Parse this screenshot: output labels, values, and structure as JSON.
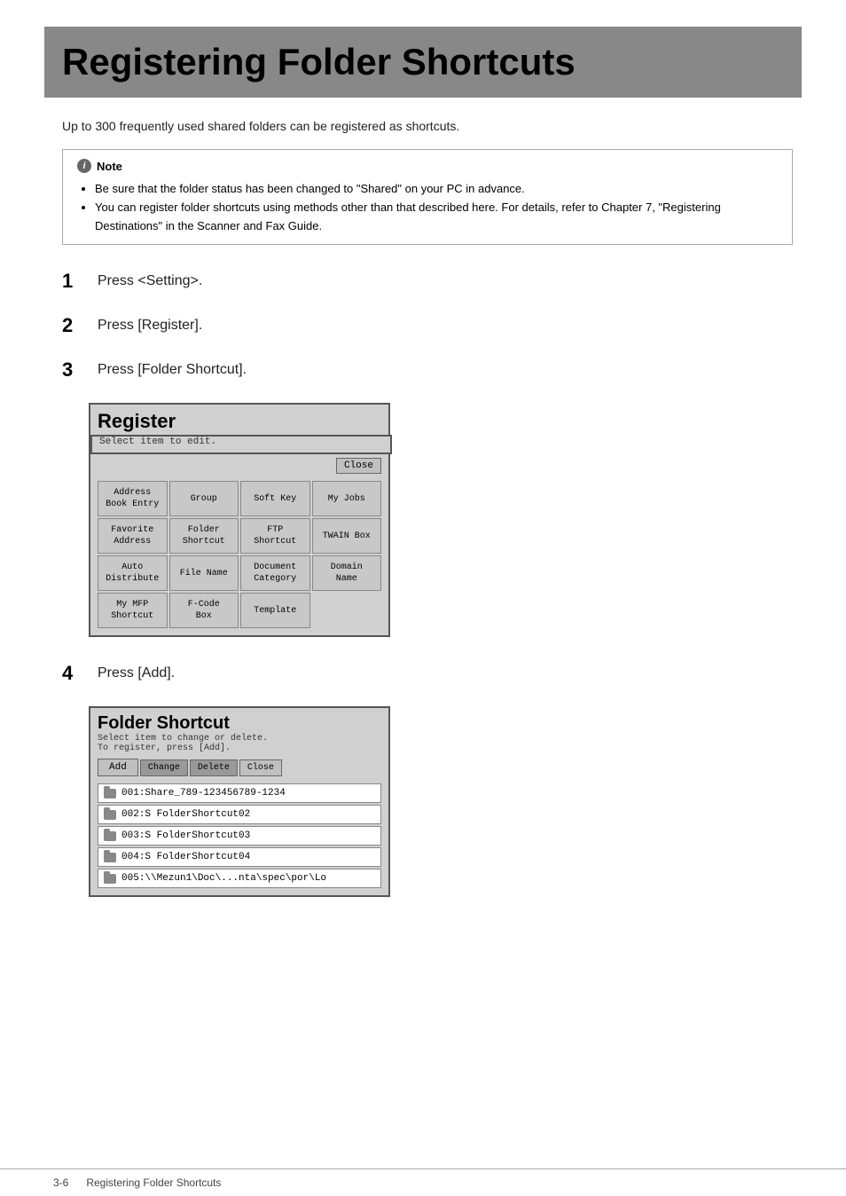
{
  "title": "Registering Folder Shortcuts",
  "intro": "Up to 300 frequently used shared folders can be registered as shortcuts.",
  "note": {
    "header": "Note",
    "items": [
      "Be sure that the folder status has been changed to \"Shared\" on your PC in advance.",
      "You can register folder shortcuts using methods other than that described here. For details, refer to Chapter 7, \"Registering Destinations\" in the Scanner and Fax Guide."
    ]
  },
  "steps": [
    {
      "number": "1",
      "text": "Press <Setting>."
    },
    {
      "number": "2",
      "text": "Press [Register]."
    },
    {
      "number": "3",
      "text": "Press [Folder Shortcut]."
    },
    {
      "number": "4",
      "text": "Press [Add]."
    }
  ],
  "register_dialog": {
    "title": "Register",
    "subtitle": "Select item to edit.",
    "close_btn": "Close",
    "grid_buttons": [
      [
        "Address\nBook Entry",
        "Group",
        "Soft Key",
        "My Jobs"
      ],
      [
        "Favorite\nAddress",
        "Folder\nShortcut",
        "FTP\nShortcut",
        "TWAIN Box"
      ],
      [
        "Auto\nDistribute",
        "File Name",
        "Document\nCategory",
        "Domain\nName"
      ],
      [
        "My MFP\nShortcut",
        "F-Code\nBox",
        "Template",
        ""
      ]
    ]
  },
  "folder_dialog": {
    "title": "Folder Shortcut",
    "subtitle1": "Select item to change or delete.",
    "subtitle2": "To register, press [Add].",
    "add_btn": "Add",
    "change_btn": "Change",
    "delete_btn": "Delete",
    "close_btn": "Close",
    "items": [
      "001:Share_789-123456789-1234",
      "002:S FolderShortcut02",
      "003:S FolderShortcut03",
      "004:S FolderShortcut04",
      "005:\\\\Mezun1\\Doc\\...nta\\spec\\por\\Lo"
    ]
  },
  "footer": {
    "page": "3-6",
    "text": "Registering Folder Shortcuts"
  }
}
